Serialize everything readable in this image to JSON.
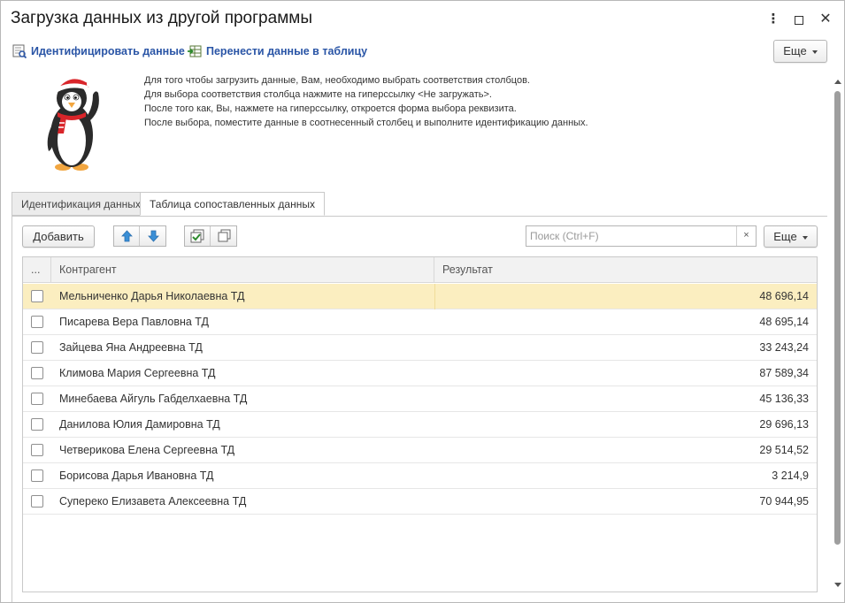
{
  "window": {
    "title": "Загрузка данных из другой программы",
    "more_glyph": "⋮",
    "close_glyph": "✕"
  },
  "commandbar": {
    "identify_label": "Идентифицировать данные",
    "transfer_label": "Перенести данные в таблицу",
    "more_label": "Еще"
  },
  "info": {
    "lines": [
      "Для того чтобы загрузить данные, Вам, необходимо выбрать соответствия столбцов.",
      "Для выбора соответствия столбца нажмите на гиперссылку <Не загружать>.",
      "После того как, Вы, нажмете на гиперссылку, откроется форма выбора реквизита.",
      "После выбора, поместите данные в соотнесенный столбец и выполните идентификацию данных."
    ]
  },
  "tabs": [
    {
      "label": "Идентификация данных",
      "active": false
    },
    {
      "label": "Таблица сопоставленных данных",
      "active": true
    }
  ],
  "toolbar": {
    "add_label": "Добавить",
    "search_placeholder": "Поиск (Ctrl+F)",
    "clear_glyph": "×",
    "more_label": "Еще"
  },
  "table": {
    "headers": {
      "check": "...",
      "counterparty": "Контрагент",
      "result": "Результат"
    },
    "rows": [
      {
        "name": "Мельниченко Дарья Николаевна ТД",
        "value": "48 696,14",
        "selected": true
      },
      {
        "name": "Писарева Вера Павловна ТД",
        "value": "48 695,14",
        "selected": false
      },
      {
        "name": "Зайцева Яна Андреевна ТД",
        "value": "33 243,24",
        "selected": false
      },
      {
        "name": "Климова Мария Сергеевна ТД",
        "value": "87 589,34",
        "selected": false
      },
      {
        "name": "Минебаева Айгуль Габделхаевна ТД",
        "value": "45 136,33",
        "selected": false
      },
      {
        "name": "Данилова Юлия Дамировна ТД",
        "value": "29 696,13",
        "selected": false
      },
      {
        "name": "Четверикова Елена Сергеевна ТД",
        "value": "29 514,52",
        "selected": false
      },
      {
        "name": "Борисова Дарья Ивановна ТД",
        "value": "3 214,9",
        "selected": false
      },
      {
        "name": "Супереко Елизавета Алексеевна ТД",
        "value": "70 944,95",
        "selected": false
      }
    ]
  },
  "colors": {
    "accent_link": "#2a55a6",
    "selected_row": "#fbeec0",
    "arrow_blue": "#3a8fd6"
  },
  "icons": {
    "identify": "identify-data-icon",
    "transfer": "transfer-to-table-icon",
    "move_up": "arrow-up-icon",
    "move_down": "arrow-down-icon",
    "check_all": "check-all-icon",
    "uncheck_all": "uncheck-all-icon",
    "mascot": "penguin-mascot-icon"
  }
}
